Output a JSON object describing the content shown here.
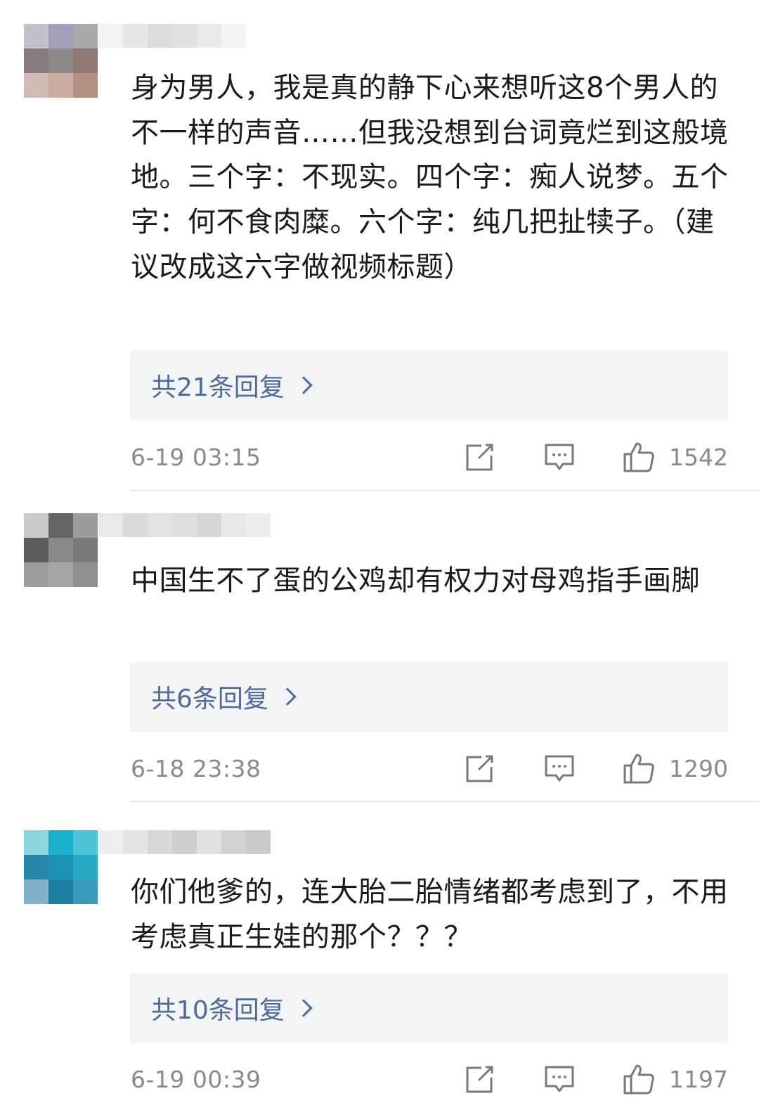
{
  "comments": [
    {
      "text": "身为男人，我是真的静下心来想听这8个男人的不一样的声音……但我没想到台词竟烂到这般境地。三个字：不现实。四个字：痴人说梦。五个字：何不食肉糜。六个字：纯几把扯犊子。（建议改成这六字做视频标题）",
      "reply_label": "共21条回复",
      "time": "6-19 03:15",
      "likes": "1542",
      "avatar_colors": [
        "#c3c0c9",
        "#a0a1b9",
        "#a8a9ab",
        "#857b81",
        "#8c8988",
        "#927875",
        "#d0bab6",
        "#c9ac9f",
        "#b48f83"
      ],
      "name_colors": [
        "#f3f3f3",
        "#e6e6e6",
        "#dcdcdc",
        "#e0e0e0",
        "#eaeaea",
        "#f5f5f5"
      ]
    },
    {
      "text": "中国生不了蛋的公鸡却有权力对母鸡指手画脚",
      "reply_label": "共6条回复",
      "time": "6-18 23:38",
      "likes": "1290",
      "avatar_colors": [
        "#c9c9c9",
        "#666666",
        "#9c9c9c",
        "#5c5c5c",
        "#8a8a8a",
        "#7a7a7a",
        "#9e9e9e",
        "#a6a6a6",
        "#8f8f8f"
      ],
      "name_colors": [
        "#e9e9e9",
        "#d9d9d9",
        "#e2e2e2",
        "#dedede",
        "#d6d6d6",
        "#e8e8e8",
        "#ececec"
      ]
    },
    {
      "text": "你们他爹的，连大胎二胎情绪都考虑到了，不用考虑真正生娃的那个？？？",
      "reply_label": "共10条回复",
      "time": "6-19 00:39",
      "likes": "1197",
      "avatar_colors": [
        "#8fd3dd",
        "#17b1cb",
        "#4cc4d6",
        "#2789a9",
        "#1c93b2",
        "#29a8c4",
        "#7eb1c8",
        "#1e7fa3",
        "#3a9cbb"
      ],
      "name_colors": [
        "#eeeeee",
        "#e3e3e3",
        "#d8d8d8",
        "#cfcfcf",
        "#e0e0e0",
        "#d2d2d2",
        "#c9c9c9"
      ]
    }
  ]
}
